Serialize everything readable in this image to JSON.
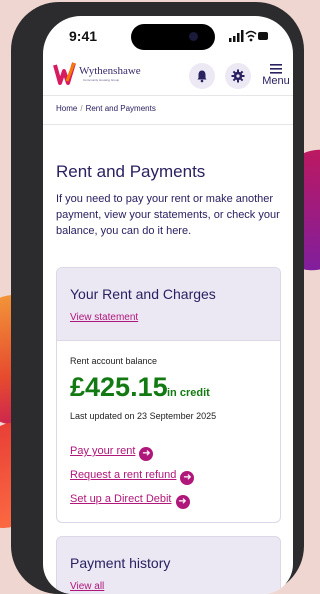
{
  "status_bar": {
    "time": "9:41"
  },
  "header": {
    "logo_name": "Wythenshawe",
    "logo_subtitle": "Community Housing Group",
    "notifications_icon": "bell-icon",
    "settings_icon": "gear-icon",
    "menu_label": "Menu"
  },
  "breadcrumb": {
    "home": "Home",
    "separator": "/",
    "current": "Rent and Payments"
  },
  "page": {
    "title": "Rent and Payments",
    "intro": "If you need to pay your rent or make another payment, view your statements, or check your balance, you can do it here."
  },
  "rent_card": {
    "title": "Your Rent and Charges",
    "view_statement": "View statement",
    "balance_label": "Rent account balance",
    "amount": "£425.15",
    "credit_label": "in credit",
    "last_updated": "Last updated on 23 September 2025",
    "actions": [
      {
        "label": "Pay your rent",
        "icon": "arrow-right-icon"
      },
      {
        "label": "Request a rent refund",
        "icon": "arrow-right-icon"
      },
      {
        "label": "Set up a Direct Debit",
        "icon": "arrow-right-icon"
      }
    ]
  },
  "history_card": {
    "title": "Payment history",
    "view_all": "View all"
  },
  "colors": {
    "brand": "#2a2160",
    "accent": "#b0177a",
    "credit": "#137a13",
    "card_header": "#ebe8f4"
  }
}
